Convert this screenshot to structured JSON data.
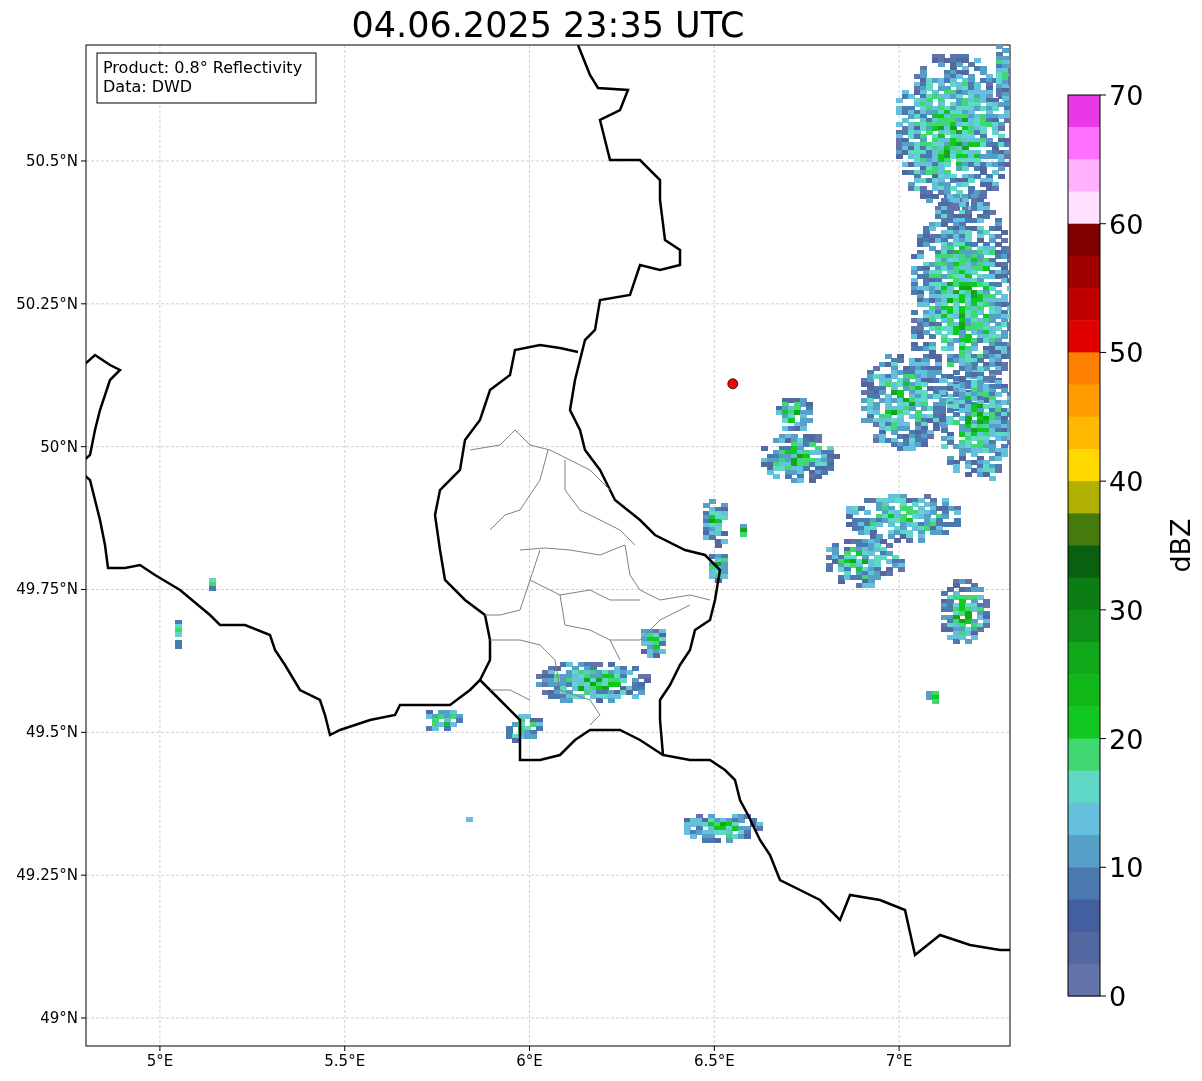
{
  "title": "04.06.2025 23:35 UTC",
  "info_box": [
    "Product: 0.8° Reflectivity",
    "Data: DWD"
  ],
  "chart_data": {
    "type": "scatter",
    "grid": true,
    "xlim": [
      4.8,
      7.3
    ],
    "ylim": [
      48.951,
      50.703
    ],
    "xticks": [
      {
        "value": 5,
        "label": "5°E"
      },
      {
        "value": 5.5,
        "label": "5.5°E"
      },
      {
        "value": 6,
        "label": "6°E"
      },
      {
        "value": 6.5,
        "label": "6.5°E"
      },
      {
        "value": 7,
        "label": "7°E"
      }
    ],
    "yticks": [
      {
        "value": 49,
        "label": "49°N"
      },
      {
        "value": 49.25,
        "label": "49.25°N"
      },
      {
        "value": 49.5,
        "label": "49.5°N"
      },
      {
        "value": 49.75,
        "label": "49.75°N"
      },
      {
        "value": 50,
        "label": "50°N"
      },
      {
        "value": 50.25,
        "label": "50.25°N"
      },
      {
        "value": 50.5,
        "label": "50.5°N"
      }
    ],
    "x": [
      6.55
    ],
    "series": [
      {
        "color": "#ff0000",
        "values": [
          50.11
        ]
      }
    ]
  },
  "colorbar": {
    "label": "dBZ",
    "ticks": [
      "70",
      "60",
      "50",
      "40",
      "30",
      "20",
      "10",
      "0"
    ],
    "bands": [
      {
        "color": "#e838e8"
      },
      {
        "color": "#ff70ff"
      },
      {
        "color": "#ffb0ff"
      },
      {
        "color": "#ffe0ff"
      },
      {
        "color": "#800000"
      },
      {
        "color": "#a00000"
      },
      {
        "color": "#c00000"
      },
      {
        "color": "#e00000"
      },
      {
        "color": "#ff8000"
      },
      {
        "color": "#ff9c00"
      },
      {
        "color": "#ffb800"
      },
      {
        "color": "#ffd800"
      },
      {
        "color": "#b0b000"
      },
      {
        "color": "#457a0c"
      },
      {
        "color": "#086010"
      },
      {
        "color": "#0c7c14"
      },
      {
        "color": "#109018"
      },
      {
        "color": "#10a818"
      },
      {
        "color": "#10b818"
      },
      {
        "color": "#10c820"
      },
      {
        "color": "#40d870"
      },
      {
        "color": "#60d8c8"
      },
      {
        "color": "#64c0dc"
      },
      {
        "color": "#56a0c8"
      },
      {
        "color": "#4a7ab0"
      },
      {
        "color": "#445fa0"
      },
      {
        "color": "#5367a0"
      },
      {
        "color": "#6474a8"
      }
    ]
  }
}
